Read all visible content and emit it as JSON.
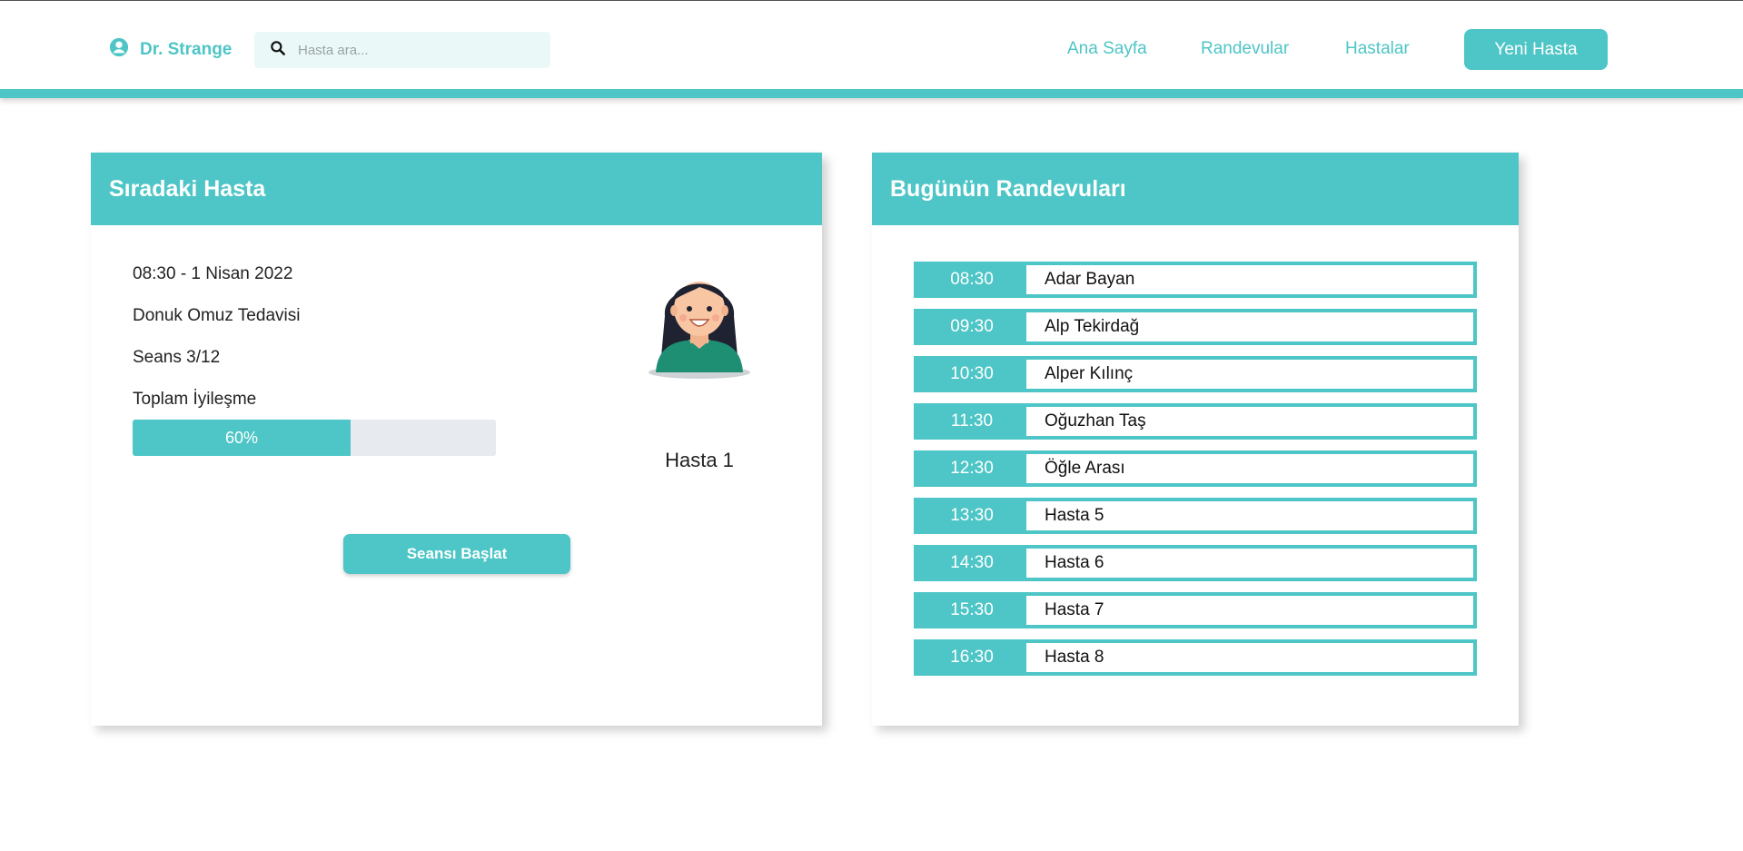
{
  "header": {
    "user_name": "Dr. Strange",
    "search_placeholder": "Hasta ara...",
    "nav": [
      "Ana Sayfa",
      "Randevular",
      "Hastalar"
    ],
    "new_patient_label": "Yeni Hasta"
  },
  "next_patient": {
    "title": "Sıradaki Hasta",
    "datetime": "08:30 - 1 Nisan 2022",
    "treatment": "Donuk Omuz Tedavisi",
    "session": "Seans 3/12",
    "recovery_label": "Toplam İyileşme",
    "recovery_percent_text": "60%",
    "recovery_value": 60,
    "patient_name": "Hasta 1",
    "start_button": "Seansı Başlat"
  },
  "appointments": {
    "title": "Bugünün Randevuları",
    "items": [
      {
        "time": "08:30",
        "name": "Adar Bayan"
      },
      {
        "time": "09:30",
        "name": "Alp Tekirdağ"
      },
      {
        "time": "10:30",
        "name": "Alper Kılınç"
      },
      {
        "time": "11:30",
        "name": "Oğuzhan Taş"
      },
      {
        "time": "12:30",
        "name": "Öğle Arası"
      },
      {
        "time": "13:30",
        "name": "Hasta 5"
      },
      {
        "time": "14:30",
        "name": "Hasta 6"
      },
      {
        "time": "15:30",
        "name": "Hasta 7"
      },
      {
        "time": "16:30",
        "name": "Hasta 8"
      }
    ]
  },
  "colors": {
    "accent": "#4ec5c6",
    "search_bg": "#eaf9f8",
    "progress_track": "#e7eaee"
  },
  "icons": {
    "user": "user-circle-icon",
    "search": "search-icon"
  }
}
